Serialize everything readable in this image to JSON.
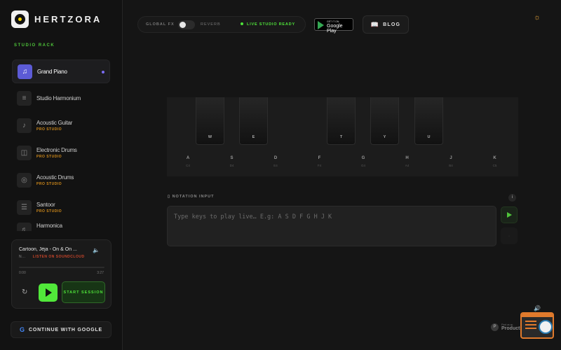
{
  "brand": {
    "name": "HERTZORA"
  },
  "sidebar": {
    "rack_title": "STUDIO RACK",
    "instruments": [
      {
        "name": "Grand Piano",
        "sub": "",
        "icon": "♫",
        "active": true
      },
      {
        "name": "Studio Harmonium",
        "sub": "",
        "icon": "≡",
        "active": false
      },
      {
        "name": "Acoustic Guitar",
        "sub": "PRO STUDIO",
        "icon": "♪",
        "active": false
      },
      {
        "name": "Electronic Drums",
        "sub": "PRO STUDIO",
        "icon": "◫",
        "active": false
      },
      {
        "name": "Acoustic Drums",
        "sub": "PRO STUDIO",
        "icon": "◎",
        "active": false
      },
      {
        "name": "Santoor",
        "sub": "PRO STUDIO",
        "icon": "☰",
        "active": false
      },
      {
        "name": "Harmonica",
        "sub": "",
        "icon": "♬",
        "active": false
      }
    ]
  },
  "player": {
    "track_title": "Cartoon, Jéja - On & On ...",
    "track_sub": "N...",
    "link_label": "LISTEN ON SOUNDCLOUD",
    "time_current": "0:00",
    "time_total": "3:27",
    "progress": 0,
    "start_label": "START SESSION"
  },
  "google": {
    "label": "CONTINUE WITH GOOGLE"
  },
  "topbar": {
    "fx_label": "GLOBAL FX",
    "reverb_label": "REVERB",
    "reverb_on": false,
    "status_label": "LIVE STUDIO READY",
    "gplay_top": "GET IT ON",
    "gplay_main": "Google Play",
    "blog_label": "BLOG"
  },
  "piano": {
    "black_keys": [
      {
        "label": "W"
      },
      {
        "label": "E"
      },
      {
        "label": "T"
      },
      {
        "label": "Y"
      },
      {
        "label": "U"
      }
    ],
    "white_keys": [
      {
        "letter": "A",
        "note": "C4"
      },
      {
        "letter": "S",
        "note": "D4"
      },
      {
        "letter": "D",
        "note": "E4"
      },
      {
        "letter": "F",
        "note": "F4"
      },
      {
        "letter": "G",
        "note": "G4"
      },
      {
        "letter": "H",
        "note": "A4"
      },
      {
        "letter": "J",
        "note": "B4"
      },
      {
        "letter": "K",
        "note": "C5"
      }
    ]
  },
  "notation": {
    "label": "NOTATION INPUT",
    "placeholder": "Type keys to play live… E.g: A S D F G H J K"
  },
  "producthunt": {
    "top": "Find us on",
    "name": "Product"
  },
  "colors": {
    "accent_green": "#4fe33a",
    "accent_purple": "#5c5bd6",
    "accent_orange": "#d08a1a",
    "soundcloud": "#c8452a"
  }
}
